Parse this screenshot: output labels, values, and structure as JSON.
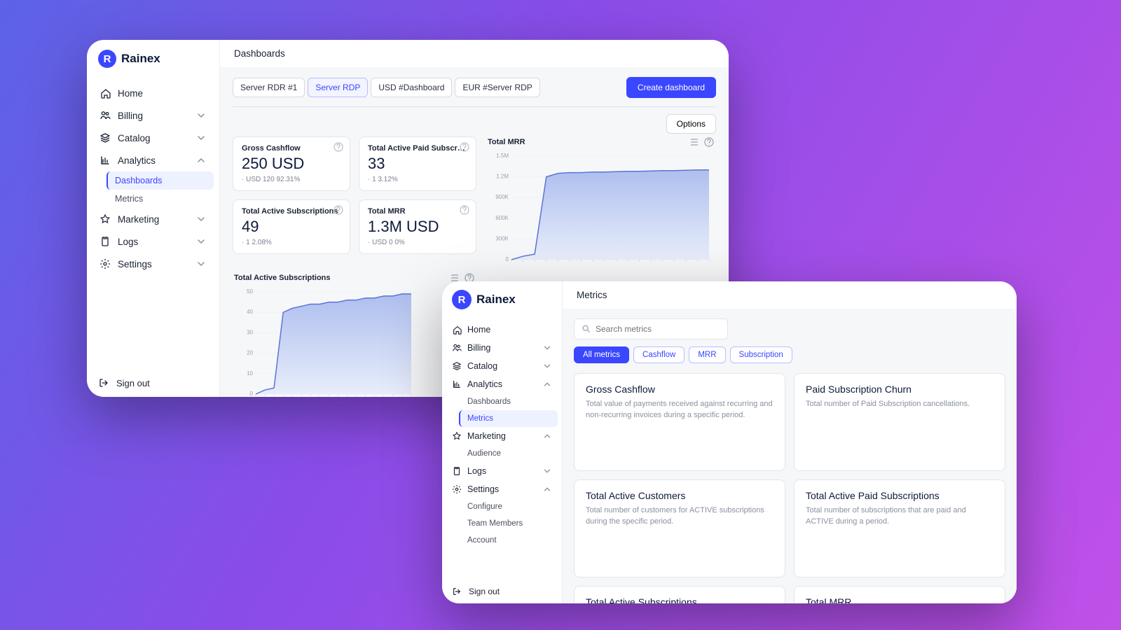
{
  "brand": {
    "mark": "R",
    "name": "Rainex"
  },
  "sidebarA": {
    "items": [
      {
        "label": "Home"
      },
      {
        "label": "Billing"
      },
      {
        "label": "Catalog"
      },
      {
        "label": "Analytics",
        "sub": [
          {
            "label": "Dashboards",
            "active": true
          },
          {
            "label": "Metrics"
          }
        ]
      },
      {
        "label": "Marketing"
      },
      {
        "label": "Logs"
      },
      {
        "label": "Settings"
      }
    ],
    "signout": "Sign out"
  },
  "sidebarB": {
    "items": [
      {
        "label": "Home"
      },
      {
        "label": "Billing"
      },
      {
        "label": "Catalog"
      },
      {
        "label": "Analytics",
        "sub": [
          {
            "label": "Dashboards"
          },
          {
            "label": "Metrics",
            "active": true
          }
        ]
      },
      {
        "label": "Marketing",
        "sub": [
          {
            "label": "Audience"
          }
        ]
      },
      {
        "label": "Logs"
      },
      {
        "label": "Settings",
        "sub": [
          {
            "label": "Configure"
          },
          {
            "label": "Team Members"
          },
          {
            "label": "Account"
          }
        ]
      }
    ],
    "signout": "Sign out"
  },
  "dashboards": {
    "crumb": "Dashboards",
    "tabs": [
      "Server RDR #1",
      "Server RDP",
      "USD #Dashboard",
      "EUR #Server RDP"
    ],
    "activeTab": 1,
    "createBtn": "Create dashboard",
    "optionsBtn": "Options",
    "kpis": [
      {
        "title": "Gross Cashflow",
        "value": "250 USD",
        "sub": "· USD 120 92.31%"
      },
      {
        "title": "Total Active Paid Subscr…",
        "value": "33",
        "sub": "· 1 3.12%"
      },
      {
        "title": "Total Active Subscriptions",
        "value": "49",
        "sub": "· 1 2.08%"
      },
      {
        "title": "Total MRR",
        "value": "1.3M USD",
        "sub": "· USD 0 0%"
      }
    ],
    "chartMRR": {
      "title": "Total MRR"
    },
    "chartTAS": {
      "title": "Total Active Subscriptions"
    }
  },
  "metrics": {
    "crumb": "Metrics",
    "searchPlaceholder": "Search metrics",
    "filters": [
      "All metrics",
      "Cashflow",
      "MRR",
      "Subscription"
    ],
    "activeFilter": 0,
    "cards": [
      {
        "title": "Gross Cashflow",
        "desc": "Total value of payments received against recurring and non-recurring invoices during a specific period."
      },
      {
        "title": "Paid Subscription Churn",
        "desc": "Total number of Paid Subscription cancellations."
      },
      {
        "title": "Total Active Customers",
        "desc": "Total number of customers for ACTIVE subscriptions during the specific period."
      },
      {
        "title": "Total Active Paid Subscriptions",
        "desc": "Total number of subscriptions that are paid and ACTIVE during a period."
      },
      {
        "title": "Total Active Subscriptions",
        "desc": ""
      },
      {
        "title": "Total MRR",
        "desc": ""
      }
    ]
  },
  "chart_data": [
    {
      "type": "area",
      "title": "Total MRR",
      "yticks": [
        "0",
        "300K",
        "600K",
        "900K",
        "1.2M",
        "1.5M"
      ],
      "ylim": [
        0,
        1500000
      ],
      "values": [
        0,
        50000,
        80000,
        1200000,
        1250000,
        1260000,
        1260000,
        1270000,
        1270000,
        1275000,
        1280000,
        1280000,
        1285000,
        1290000,
        1290000,
        1295000,
        1300000,
        1300000
      ]
    },
    {
      "type": "area",
      "title": "Total Active Subscriptions",
      "yticks": [
        "0",
        "10",
        "20",
        "30",
        "40",
        "50"
      ],
      "ylim": [
        0,
        50
      ],
      "values": [
        0,
        2,
        3,
        40,
        42,
        43,
        44,
        44,
        45,
        45,
        46,
        46,
        47,
        47,
        48,
        48,
        49,
        49
      ]
    }
  ]
}
